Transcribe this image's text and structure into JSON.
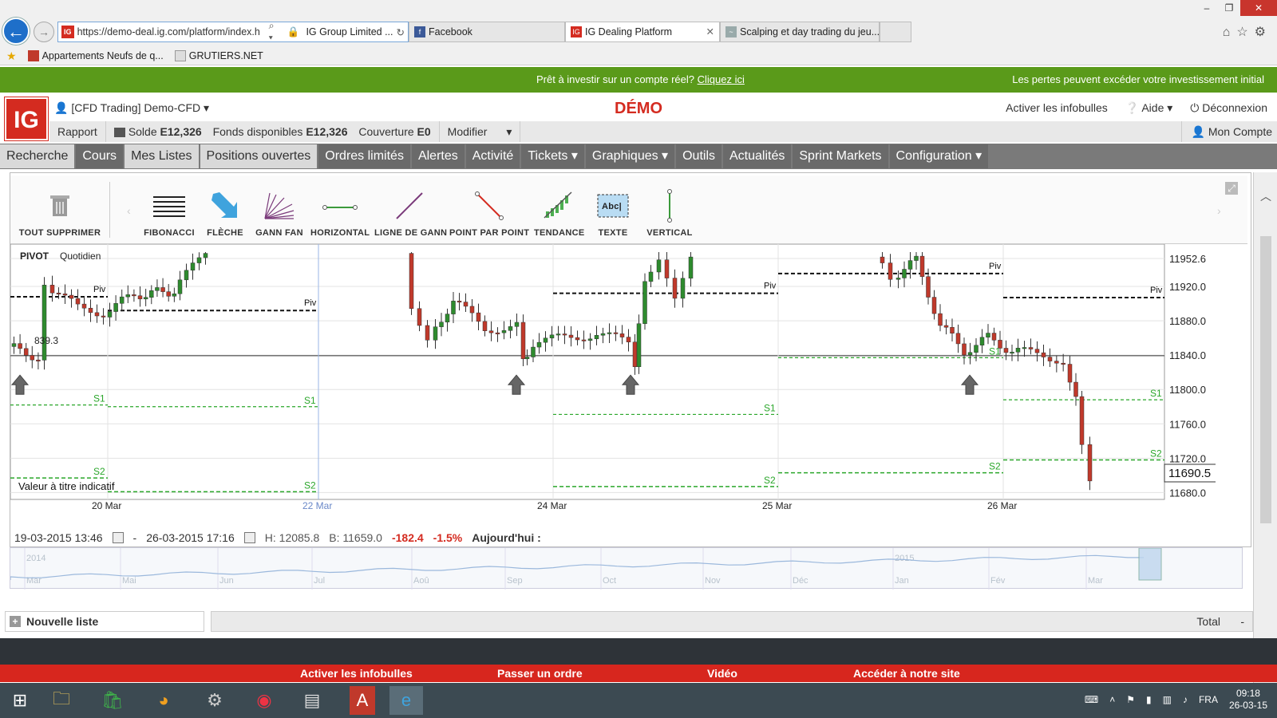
{
  "browser": {
    "url": "https://demo-deal.ig.com/platform/index.h",
    "cert": "IG Group Limited ...",
    "tabs": [
      {
        "label": "Facebook"
      },
      {
        "label": "IG Dealing Platform"
      },
      {
        "label": "Scalping et day trading du jeu..."
      }
    ],
    "favorites": [
      "Appartements Neufs de q...",
      "GRUTIERS.NET"
    ]
  },
  "banner": {
    "center_text": "Prêt à investir sur un compte réel?",
    "center_link": "Cliquez ici",
    "right_text": "Les pertes peuvent excéder votre investissement initial"
  },
  "header": {
    "logo": "IG",
    "account": "[CFD Trading] Demo-CFD",
    "demo": "DÉMO",
    "links": [
      "Activer les infobulles",
      "Aide",
      "Déconnexion"
    ]
  },
  "subbar": {
    "rapport": "Rapport",
    "solde_label": "Solde",
    "solde_value": "E12,326",
    "fonds_label": "Fonds disponibles",
    "fonds_value": "E12,326",
    "couverture_label": "Couverture",
    "couverture_value": "E0",
    "modifier": "Modifier",
    "mon_compte": "Mon Compte"
  },
  "nav": [
    "Recherche",
    "Cours",
    "Mes Listes",
    "Positions ouvertes",
    "Ordres limités",
    "Alertes",
    "Activité",
    "Tickets ▾",
    "Graphiques ▾",
    "Outils",
    "Actualités",
    "Sprint Markets",
    "Configuration ▾"
  ],
  "tools": [
    "TOUT SUPPRIMER",
    "FIBONACCI",
    "FLÈCHE",
    "GANN FAN",
    "HORIZONTAL",
    "LIGNE DE GANN",
    "POINT PAR POINT",
    "TENDANCE",
    "TEXTE",
    "VERTICAL"
  ],
  "chart": {
    "indicator": "PIVOT",
    "period": "Quotidien",
    "note": "Valeur à titre indicatif",
    "left_value": "839.3",
    "current_price": "11690.5",
    "y_labels": [
      "11952.6",
      "11920.0",
      "11880.0",
      "11840.0",
      "11800.0",
      "11760.0",
      "11720.0",
      "11680.0"
    ],
    "x_labels": [
      "20 Mar",
      "22 Mar",
      "24 Mar",
      "25 Mar",
      "26 Mar"
    ],
    "level_labels": {
      "piv": "Piv",
      "s1": "S1",
      "s2": "S2"
    },
    "footer": {
      "from": "19-03-2015 13:46",
      "to": "26-03-2015 17:16",
      "high": "H: 12085.8",
      "low": "B: 11659.0",
      "change": "-182.4",
      "change_pct": "-1.5%",
      "today": "Aujourd'hui :"
    }
  },
  "chart_data": {
    "type": "candlestick",
    "title": "",
    "y_ticks": [
      11952.6,
      11920.0,
      11880.0,
      11840.0,
      11800.0,
      11760.0,
      11720.0,
      11680.0
    ],
    "x_ticks": [
      "20 Mar",
      "22 Mar",
      "24 Mar",
      "25 Mar",
      "26 Mar"
    ],
    "high": 12085.8,
    "low": 11659.0,
    "last": 11690.5,
    "reference_line": 11839.3,
    "pivot_levels": [
      {
        "segment": "19 Mar",
        "piv": 11908,
        "s1": 11782,
        "s2": 11697
      },
      {
        "segment": "20 Mar",
        "piv": 11892,
        "s1": 11780,
        "s2": 11681
      },
      {
        "segment": "23 Mar",
        "piv": 11912,
        "s1": 11771,
        "s2": 11687
      },
      {
        "segment": "24 Mar",
        "piv": 11935,
        "s1": 11837,
        "s2": 11703
      },
      {
        "segment": "25 Mar",
        "piv": 11907,
        "s1": 11788,
        "s2": 11718
      }
    ],
    "colors": {
      "up": "#2e8b2e",
      "down": "#c0392b",
      "pivot": "#111111",
      "support": "#2aa62a"
    }
  },
  "overview": {
    "years": [
      "2014",
      "2015"
    ],
    "months": [
      "Mar",
      "Mai",
      "Jun",
      "Jul",
      "Aoû",
      "Sep",
      "Oct",
      "Nov",
      "Déc",
      "Jan",
      "Fév",
      "Mar"
    ]
  },
  "bottom": {
    "nouvelle_liste": "Nouvelle liste",
    "total": "Total",
    "total_value": "-"
  },
  "footer_links": [
    "Activer les infobulles",
    "Passer un ordre",
    "Vidéo",
    "Accéder à notre site"
  ],
  "tray": {
    "lang": "FRA",
    "time": "09:18",
    "date": "26-03-15"
  }
}
